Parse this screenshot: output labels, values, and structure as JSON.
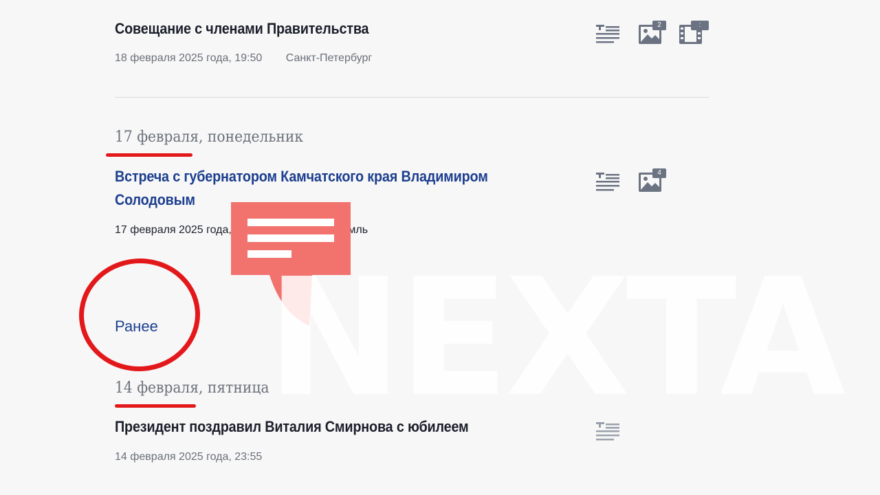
{
  "entries": [
    {
      "title": "Совещание с членами Правительства",
      "date": "18 февраля 2025 года, 19:50",
      "place": "Санкт-Петербург",
      "photo_count": "2",
      "video_badge": ":"
    },
    {
      "title_line1": "Встреча с губернатором Камчатского края Владимиром",
      "title_line2": "Солодовым",
      "date": "17 февраля 2025 года, 14:05",
      "place": "Москва, Кремль",
      "photo_count": "4"
    },
    {
      "title": "Президент поздравил Виталия Смирнова с юбилеем",
      "date": "14 февраля 2025 года, 23:55"
    }
  ],
  "date_headers": [
    {
      "day": "17 февраля",
      "weekday": ", понедельник"
    },
    {
      "day": "14 февраля",
      "weekday": ", пятница"
    }
  ],
  "earlier_link": "Ранее",
  "watermark": {
    "text": "NEXTA"
  },
  "colors": {
    "accent_red": "#e3181b",
    "link_blue": "#1d3f8f",
    "watermark_bubble": "#f2726d"
  }
}
